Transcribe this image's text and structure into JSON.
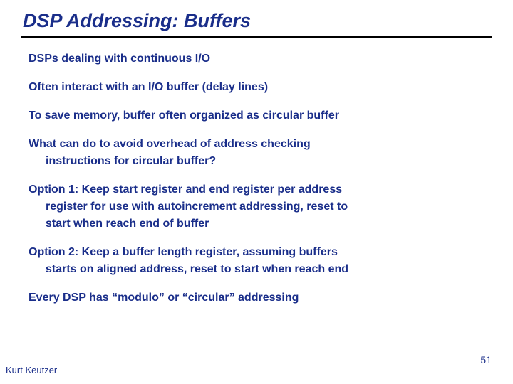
{
  "title": "DSP Addressing: Buffers",
  "paras": {
    "p1": "DSPs dealing with continuous I/O",
    "p2": "Often interact with an I/O buffer (delay lines)",
    "p3": "To save memory, buffer often organized as circular buffer",
    "p4a": "What can do to avoid overhead of address checking",
    "p4b": "instructions for circular buffer?",
    "p5a": "Option 1: Keep start register and end register per address",
    "p5b": "register for use with autoincrement addressing, reset to",
    "p5c": "start when reach end of buffer",
    "p6a": "Option 2: Keep a buffer length register, assuming buffers",
    "p6b": "starts on aligned address, reset to start when reach end",
    "p7_pre": "Every DSP has “",
    "p7_u1": "modulo",
    "p7_mid": "” or “",
    "p7_u2": "circular",
    "p7_post": "” addressing"
  },
  "footer": {
    "author": "Kurt Keutzer",
    "page": "51"
  }
}
